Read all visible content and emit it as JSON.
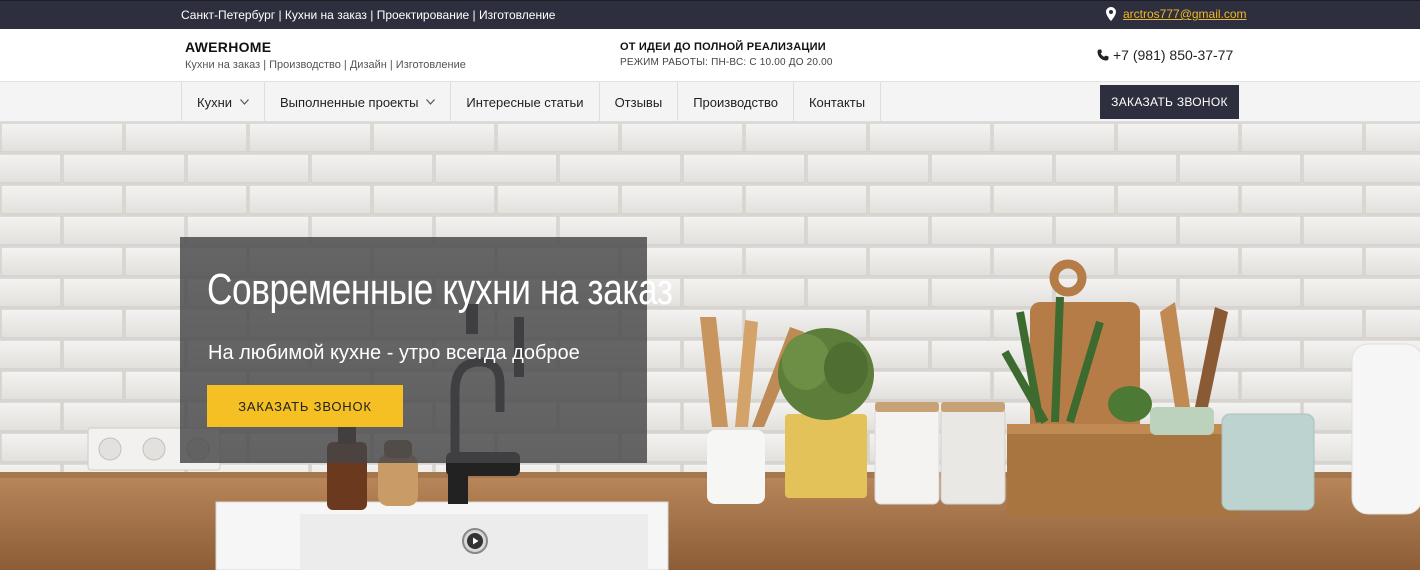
{
  "topbar": {
    "tagline": "Санкт-Петербург | Кухни на заказ | Проектирование | Изготовление",
    "email": "arctros777@gmail.com",
    "email_icon": "location-pin-icon"
  },
  "header": {
    "brand_name": "AWERHOME",
    "brand_sub": "Кухни на заказ | Производство | Дизайн | Изготовление",
    "slogan_title": "ОТ ИДЕИ ДО ПОЛНОЙ РЕАЛИЗАЦИИ",
    "slogan_hours": "РЕЖИМ РАБОТЫ: ПН-ВС: С 10.00 ДО 20.00",
    "phone": "+7 (981) 850-37-77",
    "phone_icon": "phone-icon"
  },
  "nav": {
    "items": [
      {
        "label": "Кухни",
        "has_dropdown": true
      },
      {
        "label": "Выполненные проекты",
        "has_dropdown": true
      },
      {
        "label": "Интересные статьи",
        "has_dropdown": false
      },
      {
        "label": "Отзывы",
        "has_dropdown": false
      },
      {
        "label": "Производство",
        "has_dropdown": false
      },
      {
        "label": "Контакты",
        "has_dropdown": false
      }
    ],
    "call_button": "ЗАКАЗАТЬ ЗВОНОК"
  },
  "hero": {
    "title": "Современные кухни на заказ",
    "subtitle": "На любимой кухне - утро всегда доброе",
    "button": "ЗАКАЗАТЬ ЗВОНОК",
    "play_icon": "play-icon"
  },
  "colors": {
    "dark": "#2e2f3e",
    "accent": "#f4c023",
    "link": "#f0b826"
  }
}
